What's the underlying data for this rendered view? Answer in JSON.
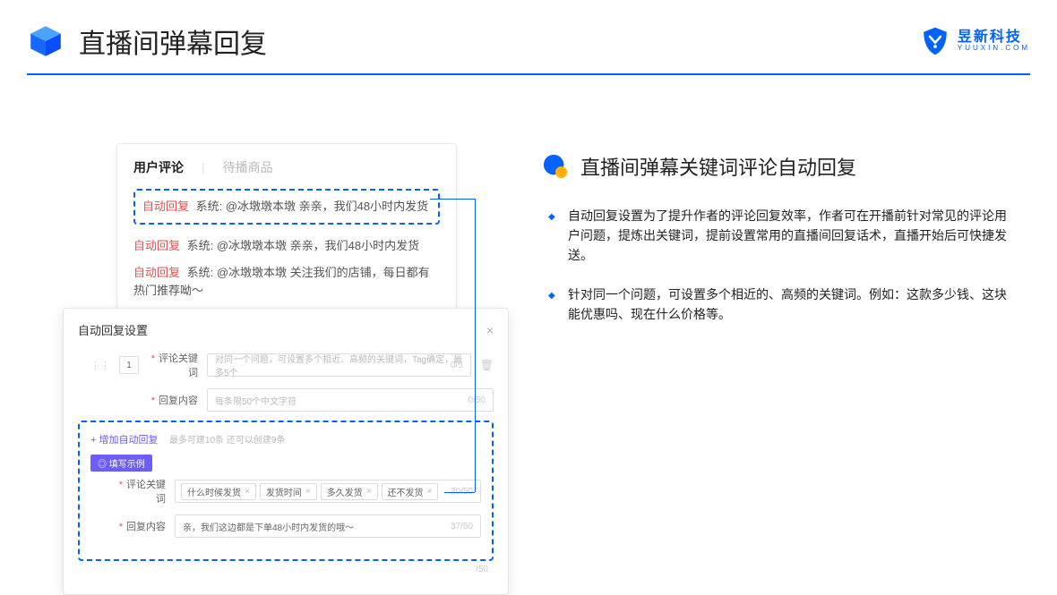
{
  "header": {
    "title": "直播间弹幕回复",
    "brand_name": "昱新科技",
    "brand_url": "YUUXIN.COM"
  },
  "right": {
    "section_title": "直播间弹幕关键词评论自动回复",
    "bullets": [
      "自动回复设置为了提升作者的评论回复效率，作者可在开播前针对常见的评论用户问题，提炼出关键词，提前设置常用的直播间回复话术，直播开始后可快捷发送。",
      "针对同一个问题，可设置多个相近的、高频的关键词。例如：这款多少钱、这块能优惠吗、现在什么价格等。"
    ]
  },
  "comments": {
    "tabs": {
      "active": "用户评论",
      "inactive": "待播商品"
    },
    "msg_hi": {
      "auto": "自动回复",
      "text": "系统: @冰墩墩本墩 亲亲，我们48小时内发货"
    },
    "msg1": {
      "auto": "自动回复",
      "text": "系统: @冰墩墩本墩 亲亲，我们48小时内发货"
    },
    "msg2": {
      "auto": "自动回复",
      "text": "系统: @冰墩墩本墩 关注我们的店铺，每日都有热门推荐呦～"
    }
  },
  "settings": {
    "card_title": "自动回复设置",
    "order": "1",
    "row1": {
      "label": "评论关键词",
      "placeholder": "对同一个问题，可设置多个相近、高频的关键词，Tag确定，最多5个",
      "counter": "0/5"
    },
    "row2": {
      "label": "回复内容",
      "placeholder": "每条限50个中文字符",
      "counter": "0/50"
    },
    "example": {
      "add_link": "+ 增加自动回复",
      "add_tip": "最多可建10条 还可以创建9条",
      "badge": "◎ 填写示例",
      "kw_label": "评论关键词",
      "kw_counter": "20/50",
      "tags": [
        "什么时候发货",
        "发货时间",
        "多久发货",
        "还不发货"
      ],
      "reply_label": "回复内容",
      "reply_text": "亲，我们这边都是下单48小时内发货的哦～",
      "reply_counter": "37/50",
      "outer_counter": "/50"
    }
  }
}
